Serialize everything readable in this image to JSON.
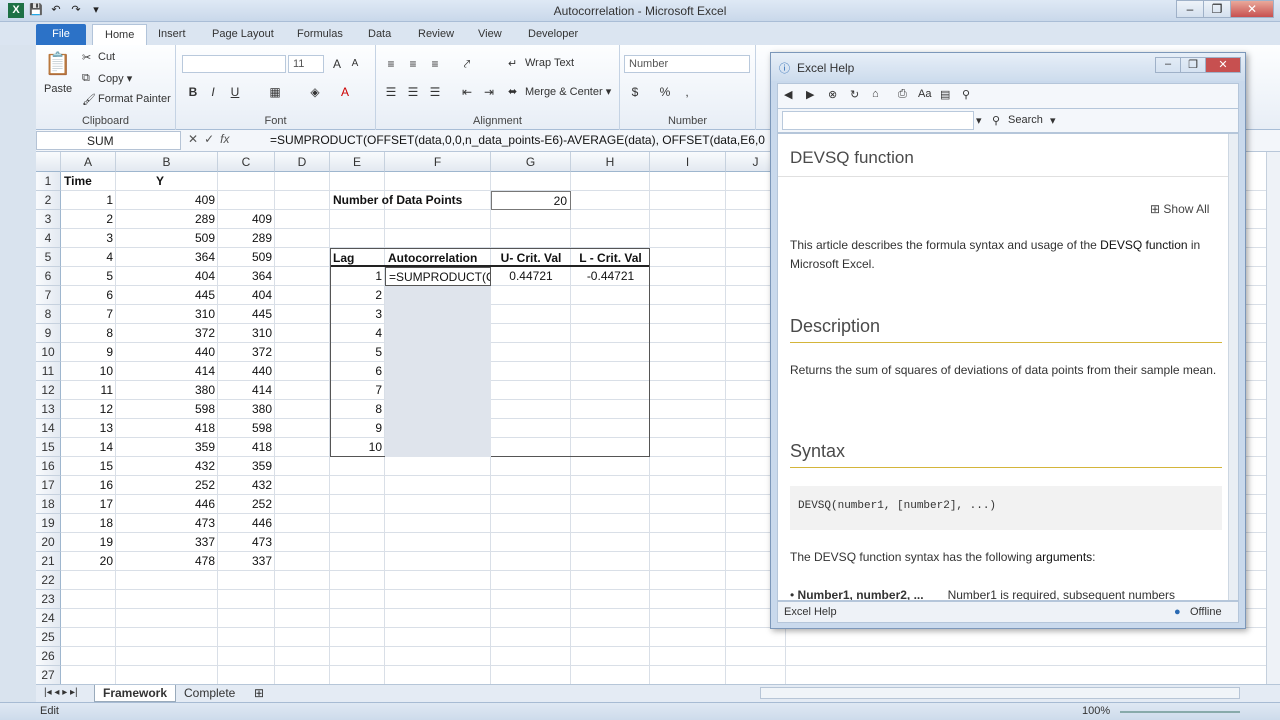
{
  "window": {
    "title": "Autocorrelation  -  Microsoft Excel",
    "controls": [
      "–",
      "❐",
      "✕"
    ]
  },
  "ribbon": {
    "tabs": [
      "File",
      "Home",
      "Insert",
      "Page Layout",
      "Formulas",
      "Data",
      "Review",
      "View",
      "Developer"
    ],
    "active_tab": "Home",
    "clipboard": {
      "label": "Clipboard",
      "paste": "Paste",
      "cut": "Cut",
      "copy": "Copy ▾",
      "format_painter": "Format Painter"
    },
    "font": {
      "label": "Font",
      "font_size": "11",
      "bold": "B",
      "italic": "I",
      "underline": "U"
    },
    "alignment": {
      "label": "Alignment",
      "wrap_text": "Wrap Text",
      "merge_center": "Merge & Center ▾"
    },
    "number": {
      "label": "Number",
      "format": "Number",
      "currency": "$",
      "percent": "%",
      "comma": ","
    }
  },
  "formula_bar": {
    "name_box": "SUM",
    "formula": "=SUMPRODUCT(OFFSET(data,0,0,n_data_points-E6)-AVERAGE(data), OFFSET(data,E6,0"
  },
  "sheet": {
    "columns": [
      "A",
      "B",
      "C",
      "D",
      "E",
      "F",
      "G",
      "H",
      "I",
      "J"
    ],
    "rows": [
      "1",
      "2",
      "3",
      "4",
      "5",
      "6",
      "7",
      "8",
      "9",
      "10",
      "11",
      "12",
      "13",
      "14",
      "15",
      "16",
      "17",
      "18",
      "19",
      "20",
      "21",
      "22",
      "23",
      "24",
      "25",
      "26",
      "27"
    ],
    "header_time": "Time",
    "header_y": "Y",
    "time": [
      "1",
      "2",
      "3",
      "4",
      "5",
      "6",
      "7",
      "8",
      "9",
      "10",
      "11",
      "12",
      "13",
      "14",
      "15",
      "16",
      "17",
      "18",
      "19",
      "20"
    ],
    "y": [
      "409",
      "289",
      "509",
      "364",
      "404",
      "445",
      "310",
      "372",
      "440",
      "414",
      "380",
      "598",
      "418",
      "359",
      "432",
      "252",
      "446",
      "473",
      "337",
      "478"
    ],
    "c_lag": [
      "409",
      "289",
      "509",
      "364",
      "404",
      "445",
      "310",
      "372",
      "440",
      "414",
      "380",
      "598",
      "418",
      "359",
      "432",
      "252",
      "446",
      "473",
      "337"
    ],
    "n_points_label": "Number of Data Points",
    "n_points_value": "20",
    "table_headers": [
      "Lag",
      "Autocorrelation",
      "U- Crit. Val",
      "L - Crit. Val"
    ],
    "lags": [
      "1",
      "2",
      "3",
      "4",
      "5",
      "6",
      "7",
      "8",
      "9",
      "10"
    ],
    "editing_cell": "=SUMPRODUCT(O",
    "u_crit": "0.44721",
    "l_crit": "-0.44721"
  },
  "sheet_tabs": [
    "Framework",
    "Complete"
  ],
  "status": {
    "mode": "Edit",
    "zoom": "100%"
  },
  "help": {
    "title": "Excel Help",
    "search_label": "Search",
    "page_title": "DEVSQ function",
    "show_all": "Show All",
    "intro_prefix": "This article describes the formula syntax and usage of the ",
    "intro_link": "DEVSQ function",
    "intro_suffix": " in Microsoft Excel.",
    "description_heading": "Description",
    "description_text": "Returns the sum of squares of deviations of data points from their sample mean.",
    "syntax_heading": "Syntax",
    "syntax_code": "DEVSQ(number1, [number2], ...)",
    "syntax_text_prefix": "The DEVSQ function syntax has the following ",
    "syntax_link": "arguments",
    "syntax_text_suffix": ":",
    "arg_name": "Number1, number2, ...",
    "arg_desc": "Number1 is required, subsequent numbers",
    "footer_left": "Excel Help",
    "footer_right": "Offline"
  }
}
